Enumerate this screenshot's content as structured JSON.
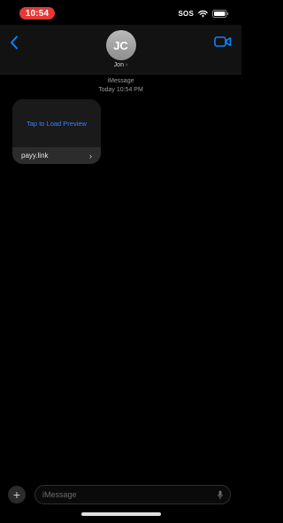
{
  "status_bar": {
    "time": "10:54",
    "sos": "SOS",
    "wifi_icon": "wifi-icon",
    "battery_icon": "battery-icon",
    "time_pill_color": "#e53935"
  },
  "header": {
    "back_icon": "chevron-left-icon",
    "avatar_initials": "JC",
    "contact_name": "Jon",
    "contact_chevron": "›",
    "video_icon": "video-camera-icon",
    "accent_color": "#0a84ff"
  },
  "conversation": {
    "service": "iMessage",
    "timestamp": "Today 10:54 PM",
    "link_preview": {
      "action_text": "Tap to Load Preview",
      "domain": "payy.link",
      "chevron": "›",
      "link_color": "#3b82f6"
    }
  },
  "compose": {
    "add_label": "+",
    "placeholder": "iMessage",
    "mic_icon": "microphone-icon"
  }
}
